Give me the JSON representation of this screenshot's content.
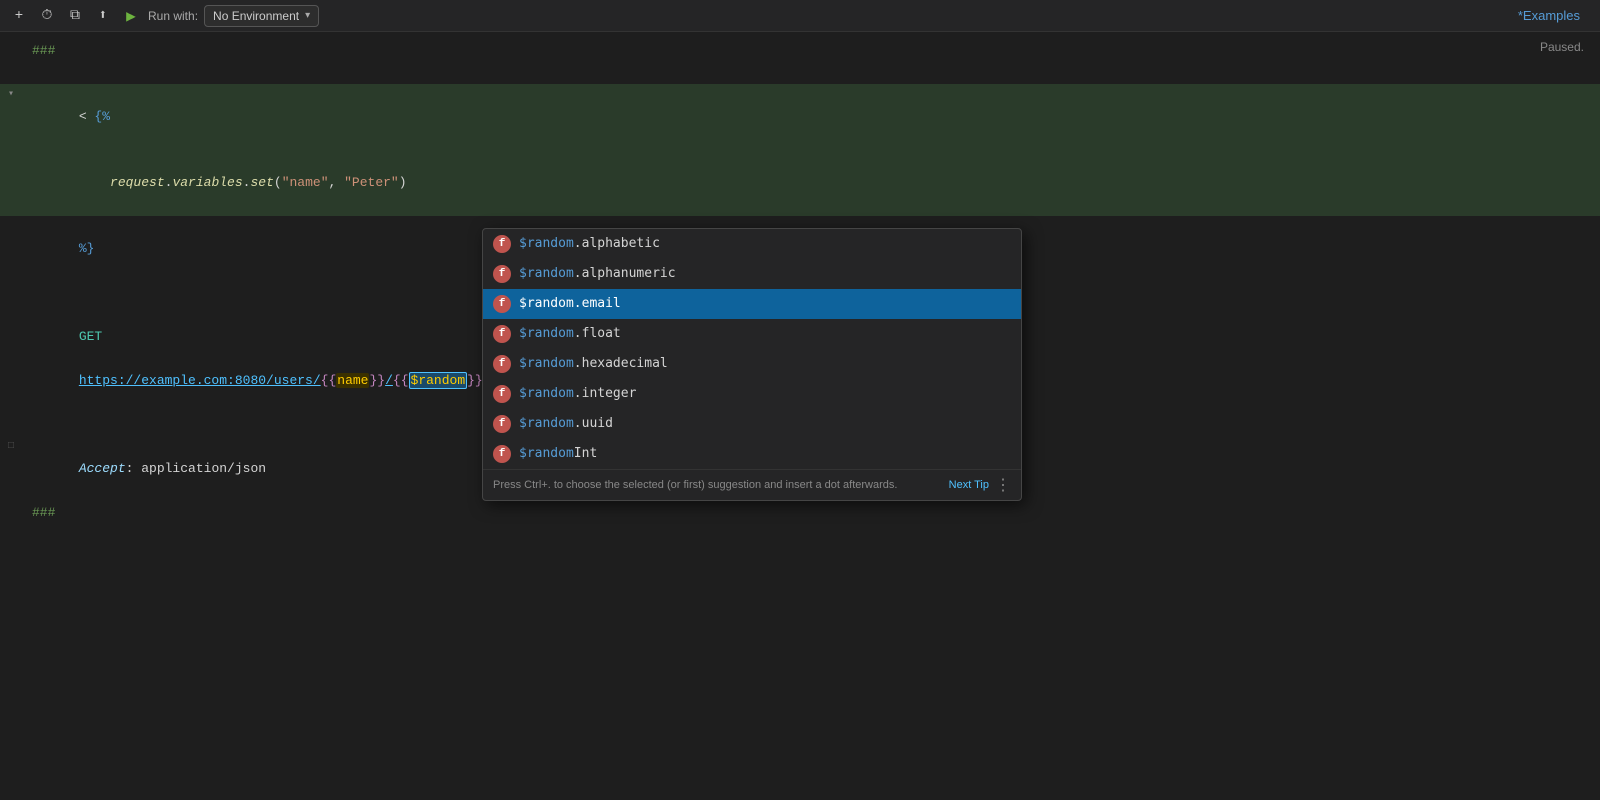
{
  "toolbar": {
    "add_label": "+",
    "run_with_label": "Run with:",
    "env_dropdown_label": "No Environment",
    "tab_title": "*Examples",
    "status": "Paused."
  },
  "editor": {
    "lines": [
      {
        "id": 1,
        "type": "comment",
        "content": "###",
        "highlighted": false
      },
      {
        "id": 2,
        "type": "empty",
        "content": "",
        "highlighted": false
      },
      {
        "id": 3,
        "type": "template-open",
        "content": "< {%",
        "highlighted": true,
        "foldable": true
      },
      {
        "id": 4,
        "type": "code",
        "content": "    request.variables.set(\"name\", \"Peter\")",
        "highlighted": true
      },
      {
        "id": 5,
        "type": "template-close",
        "content": "%}",
        "highlighted": false
      },
      {
        "id": 6,
        "type": "empty2",
        "content": "",
        "highlighted": false
      },
      {
        "id": 7,
        "type": "request",
        "content": "GET https://example.com:8080/users/{{name}}/{{$random}}",
        "highlighted": false
      },
      {
        "id": 8,
        "type": "empty3",
        "content": "",
        "highlighted": false
      },
      {
        "id": 9,
        "type": "header",
        "content": "Accept: application/json",
        "highlighted": false
      },
      {
        "id": 10,
        "type": "comment2",
        "content": "###",
        "highlighted": false
      }
    ]
  },
  "autocomplete": {
    "items": [
      {
        "id": 1,
        "prefix": "$random",
        "suffix": ".alphabetic",
        "selected": false
      },
      {
        "id": 2,
        "prefix": "$random",
        "suffix": ".alphanumeric",
        "selected": false
      },
      {
        "id": 3,
        "prefix": "$random",
        "suffix": ".email",
        "selected": true
      },
      {
        "id": 4,
        "prefix": "$random",
        "suffix": ".float",
        "selected": false
      },
      {
        "id": 5,
        "prefix": "$random",
        "suffix": ".hexadecimal",
        "selected": false
      },
      {
        "id": 6,
        "prefix": "$random",
        "suffix": ".integer",
        "selected": false
      },
      {
        "id": 7,
        "prefix": "$random",
        "suffix": ".uuid",
        "selected": false
      },
      {
        "id": 8,
        "prefix": "$random",
        "suffix": "Int",
        "selected": false,
        "is_int": true
      }
    ],
    "footer_tip": "Press Ctrl+. to choose the selected (or first) suggestion and insert a dot afterwards.",
    "next_tip_label": "Next Tip"
  }
}
